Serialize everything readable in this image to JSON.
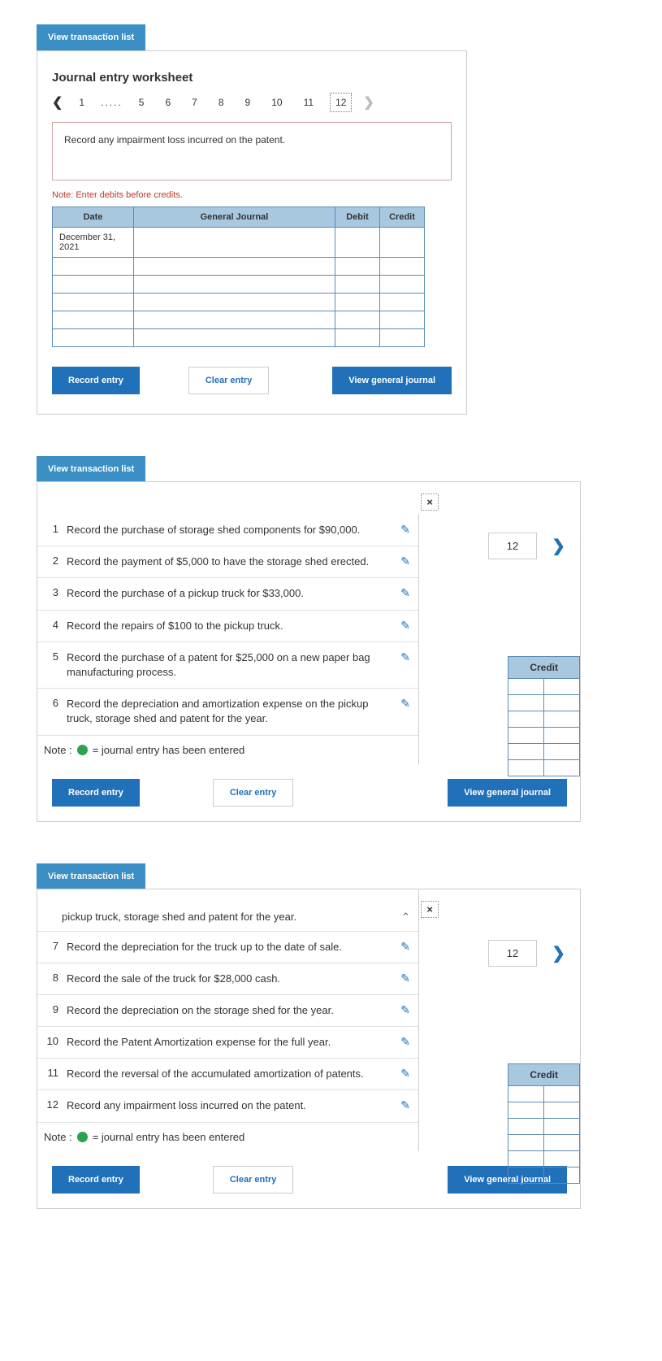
{
  "buttons": {
    "view_transaction_list": "View transaction list",
    "record_entry": "Record entry",
    "clear_entry": "Clear entry",
    "view_general_journal": "View general journal"
  },
  "worksheet": {
    "title": "Journal entry worksheet",
    "tabs": [
      "1",
      ".....",
      "5",
      "6",
      "7",
      "8",
      "9",
      "10",
      "11",
      "12"
    ],
    "active_tab": "12",
    "instruction": "Record any impairment loss incurred on the patent.",
    "note": "Note: Enter debits before credits.",
    "columns": {
      "date": "Date",
      "general_journal": "General Journal",
      "debit": "Debit",
      "credit": "Credit"
    },
    "date_value": "December 31, 2021"
  },
  "panel2": {
    "close": "×",
    "right_tab": "12",
    "credit_header": "Credit",
    "transactions": [
      {
        "num": "1",
        "text": "Record the purchase of storage shed components for $90,000."
      },
      {
        "num": "2",
        "text": "Record the payment of $5,000 to have the storage shed erected."
      },
      {
        "num": "3",
        "text": "Record the purchase of a pickup truck for $33,000."
      },
      {
        "num": "4",
        "text": "Record the repairs of $100 to the pickup truck."
      },
      {
        "num": "5",
        "text": "Record the purchase of a patent for $25,000 on a new paper bag manufacturing process."
      },
      {
        "num": "6",
        "text": "Record the depreciation and amortization expense on the pickup truck, storage shed and patent for the year."
      }
    ],
    "note_label": "Note :",
    "note_text": "= journal entry has been entered"
  },
  "panel3": {
    "close": "×",
    "right_tab": "12",
    "credit_header": "Credit",
    "continued": "pickup truck, storage shed and patent for the year.",
    "transactions": [
      {
        "num": "7",
        "text": "Record the depreciation for the truck up to the date of sale."
      },
      {
        "num": "8",
        "text": "Record the sale of the truck for $28,000 cash."
      },
      {
        "num": "9",
        "text": "Record the depreciation on the storage shed for the year."
      },
      {
        "num": "10",
        "text": "Record the Patent Amortization expense for the full year."
      },
      {
        "num": "11",
        "text": "Record the reversal of the accumulated amortization of patents."
      },
      {
        "num": "12",
        "text": "Record any impairment loss incurred on the patent."
      }
    ],
    "note_label": "Note :",
    "note_text": "= journal entry has been entered"
  }
}
